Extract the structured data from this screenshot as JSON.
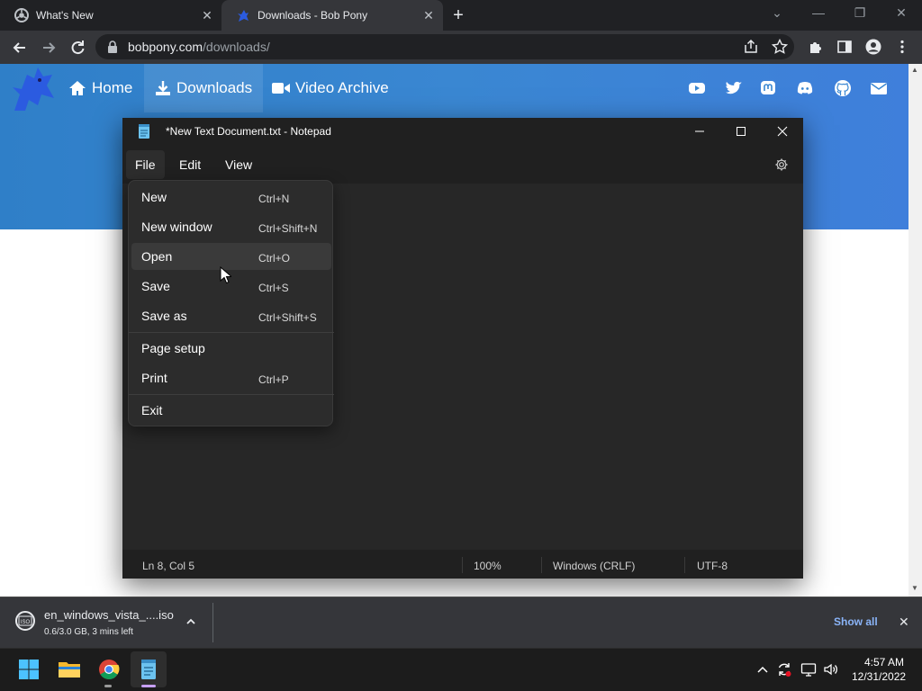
{
  "browser": {
    "tabs": [
      {
        "title": "What's New",
        "close": "✕"
      },
      {
        "title": "Downloads - Bob Pony",
        "close": "✕"
      }
    ],
    "new_tab": "+",
    "window_controls": {
      "minimize": "—",
      "restore": "❐",
      "close": "✕",
      "tab_search": "⌄"
    },
    "url_host": "bobpony.com",
    "url_path": "/downloads/"
  },
  "site": {
    "nav": [
      {
        "label": "Home",
        "icon": "home-icon"
      },
      {
        "label": "Downloads",
        "icon": "download-icon"
      },
      {
        "label": "Video Archive",
        "icon": "video-camera-icon"
      }
    ],
    "social_icons": [
      "youtube-icon",
      "twitter-icon",
      "mastodon-icon",
      "discord-icon",
      "github-icon",
      "mail-icon"
    ],
    "colors": {
      "header": "#3a87d2",
      "logo": "#2b5be0"
    }
  },
  "notepad": {
    "title": "*New Text Document.txt - Notepad",
    "menu": [
      "File",
      "Edit",
      "View"
    ],
    "file_menu": [
      {
        "label": "New",
        "shortcut": "Ctrl+N"
      },
      {
        "label": "New window",
        "shortcut": "Ctrl+Shift+N"
      },
      {
        "label": "Open",
        "shortcut": "Ctrl+O"
      },
      {
        "label": "Save",
        "shortcut": "Ctrl+S"
      },
      {
        "label": "Save as",
        "shortcut": "Ctrl+Shift+S"
      },
      {
        "label": "Page setup",
        "shortcut": ""
      },
      {
        "label": "Print",
        "shortcut": "Ctrl+P"
      },
      {
        "label": "Exit",
        "shortcut": ""
      }
    ],
    "status": {
      "position": "Ln 8, Col 5",
      "zoom": "100%",
      "line_ending": "Windows (CRLF)",
      "encoding": "UTF-8"
    }
  },
  "download": {
    "filename": "en_windows_vista_....iso",
    "status": "0.6/3.0 GB, 3 mins left",
    "show_all": "Show all",
    "close": "✕"
  },
  "taskbar": {
    "apps": [
      "windows-start-icon",
      "file-explorer-icon",
      "chrome-icon",
      "notepad-icon"
    ],
    "time": "4:57 AM",
    "date": "12/31/2022"
  }
}
